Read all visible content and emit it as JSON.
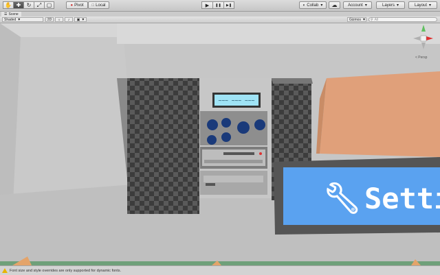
{
  "toolbar": {
    "tools": [
      {
        "name": "hand-tool",
        "glyph": "✋"
      },
      {
        "name": "move-tool",
        "glyph": "✚"
      },
      {
        "name": "rotate-tool",
        "glyph": "↻"
      },
      {
        "name": "scale-tool",
        "glyph": "⤢"
      },
      {
        "name": "rect-tool",
        "glyph": "▢"
      }
    ],
    "pivot_label": "Pivot",
    "local_label": "Local",
    "play_glyph": "▶",
    "pause_glyph": "❚❚",
    "step_glyph": "▶❚",
    "collab_label": "Collab",
    "account_label": "Account",
    "layers_label": "Layers",
    "layout_label": "Layout"
  },
  "scene_tab": {
    "label": "Scene"
  },
  "scene_bar": {
    "shading_mode": "Shaded",
    "mode_2d": "2D",
    "gizmos_label": "Gizmos",
    "search_placeholder": "All"
  },
  "gizmo": {
    "label": "< Persp"
  },
  "stereo": {
    "display_text": "~~~ ~~~ ~~~",
    "knob_color": "#1a3a7a",
    "display_color": "#9fe3f5"
  },
  "settings_panel": {
    "label": "Settin",
    "bg_color": "#5aa2f0"
  },
  "status": {
    "message": "Font size and style overrides are only supported for dynamic fonts."
  }
}
